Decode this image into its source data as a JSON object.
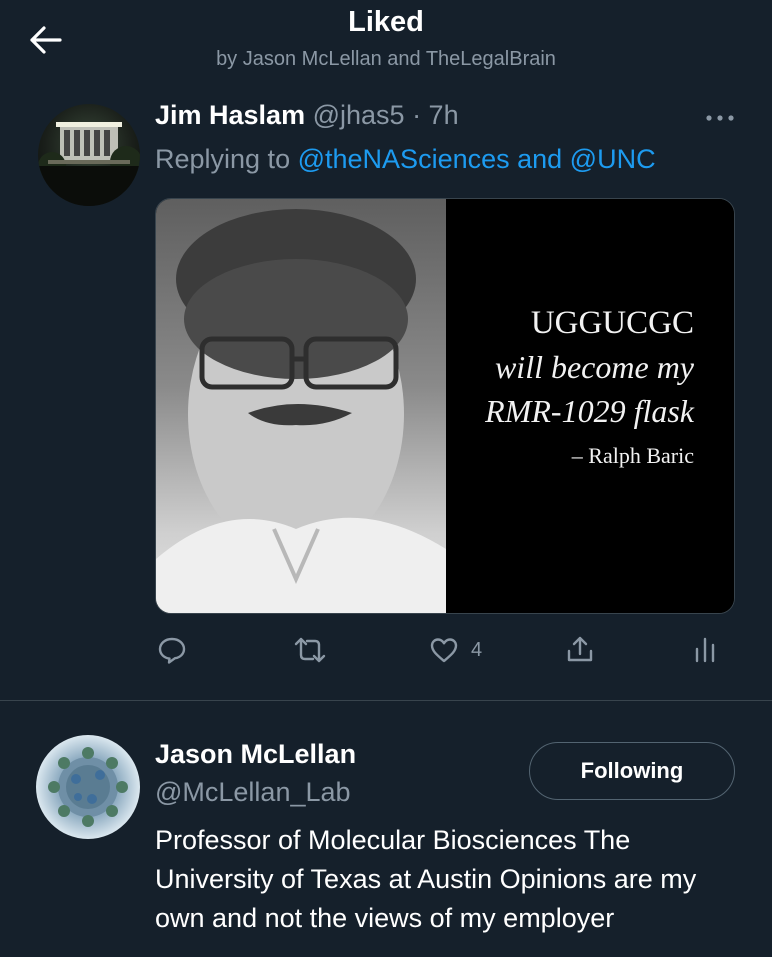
{
  "header": {
    "title": "Liked",
    "subtitle": "by Jason McLellan and TheLegalBrain"
  },
  "tweet": {
    "author_name": "Jim Haslam",
    "author_meta": "@jhas5 · 7h",
    "replying_prefix": "Replying to",
    "replying_mentions": "@theNASciences and @UNC",
    "image_text": {
      "line1": "UGGUCGC",
      "line2": "will become my",
      "line3": "RMR-1029 flask",
      "attribution": "– Ralph Baric"
    },
    "actions": {
      "reply_icon": "reply-icon",
      "retweet_icon": "retweet-icon",
      "like_icon": "heart-icon",
      "like_count": "4",
      "share_icon": "share-icon",
      "analytics_icon": "analytics-icon"
    }
  },
  "user_cell": {
    "name": "Jason McLellan",
    "handle": "@McLellan_Lab",
    "follow_label": "Following",
    "bio": "Professor of Molecular Biosciences The University of Texas at Austin Opinions are my own and not the views of my employer"
  },
  "colors": {
    "background": "#15202b",
    "accent": "#1d9bf0",
    "secondary_text": "#8b98a5",
    "divider": "#38444d"
  }
}
